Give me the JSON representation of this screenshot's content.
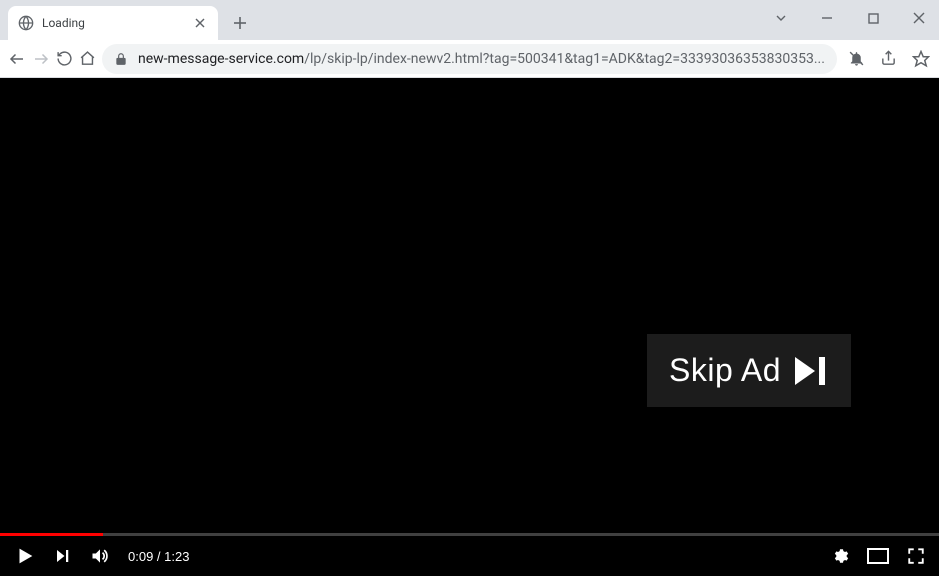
{
  "tab": {
    "title": "Loading"
  },
  "omnibox": {
    "domain": "new-message-service.com",
    "path": "/lp/skip-lp/index-newv2.html?tag=500341&tag1=ADK&tag2=33393036353830353..."
  },
  "player": {
    "time_elapsed": "0:09",
    "time_total": "1:23",
    "progress_percent": 11
  },
  "skip_ad": {
    "label": "Skip Ad"
  }
}
